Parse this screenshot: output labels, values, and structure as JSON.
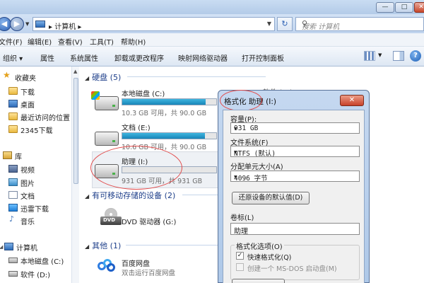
{
  "window": {
    "min_glyph": "—",
    "max_glyph": "□",
    "close_glyph": "✕"
  },
  "address": {
    "back_glyph": "◀",
    "forward_glyph": "▶",
    "breadcrumb": "▸ 计算机 ▸",
    "refresh_glyph": "↻",
    "search_placeholder": "搜索 计算机",
    "search_glyph": "⚲"
  },
  "menu": [
    "文件(F)",
    "编辑(E)",
    "查看(V)",
    "工具(T)",
    "帮助(H)"
  ],
  "toolbar": {
    "organize": "组织 ▾",
    "items": [
      "属性",
      "系统属性",
      "卸载或更改程序",
      "映射网络驱动器",
      "打开控制面板"
    ],
    "help_glyph": "?"
  },
  "nav": {
    "favorites": "收藏夹",
    "fav_items": [
      "下载",
      "桌面",
      "最近访问的位置",
      "2345下载"
    ],
    "library": "库",
    "lib_items": [
      "视频",
      "图片",
      "文档",
      "迅雷下载",
      "音乐"
    ],
    "computer": "计算机",
    "computer_items": [
      "本地磁盘 (C:)",
      "软件 (D:)"
    ]
  },
  "content": {
    "hdd_header": "硬盘 (5)",
    "drives": [
      {
        "name": "本地磁盘 (C:)",
        "sub": "10.3 GB 可用，共 90.0 GB",
        "used_fraction": 0.886
      },
      {
        "name": "文档 (E:)",
        "sub": "10.6 GB 可用，共 90.0 GB",
        "used_fraction": 0.882
      },
      {
        "name": "助理 (I:)",
        "sub": "931 GB 可用，共 931 GB",
        "used_fraction": 0.0
      }
    ],
    "partial_label": "软件 (D:)",
    "removable_header": "有可移动存储的设备 (2)",
    "dvd_name": "DVD 驱动器 (G:)",
    "dvd_badge": "DVD",
    "other_header": "其他 (1)",
    "baidu_name": "百度网盘",
    "baidu_sub": "双击运行百度网盘"
  },
  "dialog": {
    "title": "格式化 助理 (I:)",
    "close_glyph": "✕",
    "capacity_label": "容量(P):",
    "capacity_value": "931 GB",
    "fs_label": "文件系统(F)",
    "fs_value": "NTFS (默认)",
    "alloc_label": "分配单元大小(A)",
    "alloc_value": "4096 字节",
    "restore_button": "还原设备的默认值(D)",
    "volume_label": "卷标(L)",
    "volume_value": "助理",
    "options_label": "格式化选项(O)",
    "quick_format": "快速格式化(Q)",
    "quick_checked": "✓",
    "msdos": "创建一个 MS-DOS 启动盘(M)"
  }
}
